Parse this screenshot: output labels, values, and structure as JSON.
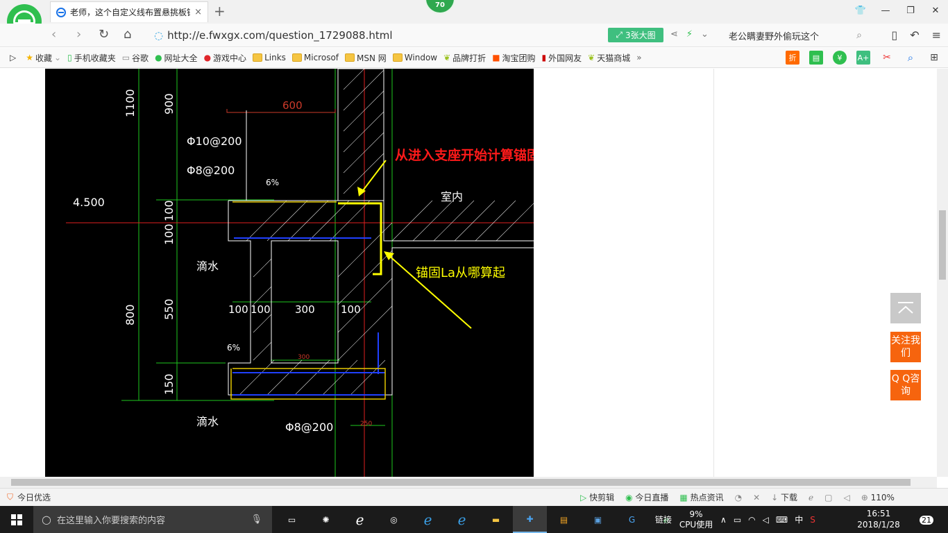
{
  "tab": {
    "title": "老师，这个自定义线布置悬挑板锚",
    "close": "×"
  },
  "badge": {
    "count": "70"
  },
  "address": {
    "url": "http://e.fwxgx.com/question_1729088.html",
    "big_image_label": "3张大图",
    "search_text": "老公瞒妻野外偷玩这个"
  },
  "bookmarks": [
    {
      "label": "收藏",
      "icon": "star-icon"
    },
    {
      "label": "手机收藏夹",
      "icon": "phone-icon"
    },
    {
      "label": "谷歌",
      "icon": "page-icon"
    },
    {
      "label": "网址大全",
      "icon": "globe-icon"
    },
    {
      "label": "游戏中心",
      "icon": "game-icon"
    },
    {
      "label": "Links",
      "icon": "folder-icon"
    },
    {
      "label": "Microsof",
      "icon": "folder-icon"
    },
    {
      "label": "MSN 网",
      "icon": "folder-icon"
    },
    {
      "label": "Window",
      "icon": "folder-icon"
    },
    {
      "label": "品牌打折",
      "icon": "leaf-icon"
    },
    {
      "label": "淘宝团购",
      "icon": "taobao-icon"
    },
    {
      "label": "外国网友",
      "icon": "page-icon"
    },
    {
      "label": "天猫商城",
      "icon": "leaf-icon"
    }
  ],
  "bookmarks_more": "»",
  "drawing": {
    "annotation_top": "从进入支座开始计算锚固长度",
    "annotation_mid": "锚固La从哪算起",
    "elevation": "4.500",
    "room_label": "室内",
    "drip_top": "滴水",
    "drip_bottom": "滴水",
    "rebar_1": "Φ10@200",
    "rebar_2": "Φ8@200",
    "rebar_3": "Φ8@200",
    "slope_top": "6%",
    "slope_bottom": "6%",
    "dim_600": "600",
    "dim_1100": "1100",
    "dim_900": "900",
    "dim_100a": "100",
    "dim_100b": "100",
    "dim_800": "800",
    "dim_550": "550",
    "dim_150": "150",
    "dim_row_100a": "100",
    "dim_row_100b": "100",
    "dim_row_300": "300",
    "dim_row_100c": "100",
    "dim_inner_300": "300",
    "dim_250": "250"
  },
  "side_buttons": {
    "follow": "关注我们",
    "qq": "Q Q咨询"
  },
  "status": {
    "left": "今日优选",
    "items": [
      "快剪辑",
      "今日直播",
      "热点资讯",
      "下载"
    ],
    "zoom": "110%"
  },
  "taskbar": {
    "search_placeholder": "在这里输入你要搜索的内容",
    "link_label": "链接",
    "cpu_percent": "9%",
    "cpu_label": "CPU使用",
    "ime": "中",
    "time": "16:51",
    "date": "2018/1/28",
    "notifications": "21"
  },
  "colors": {
    "accent": "#2fa84f",
    "orange": "#f6640e",
    "annotation_red": "#ff1a1a",
    "annotation_yellow": "#ffff00"
  }
}
